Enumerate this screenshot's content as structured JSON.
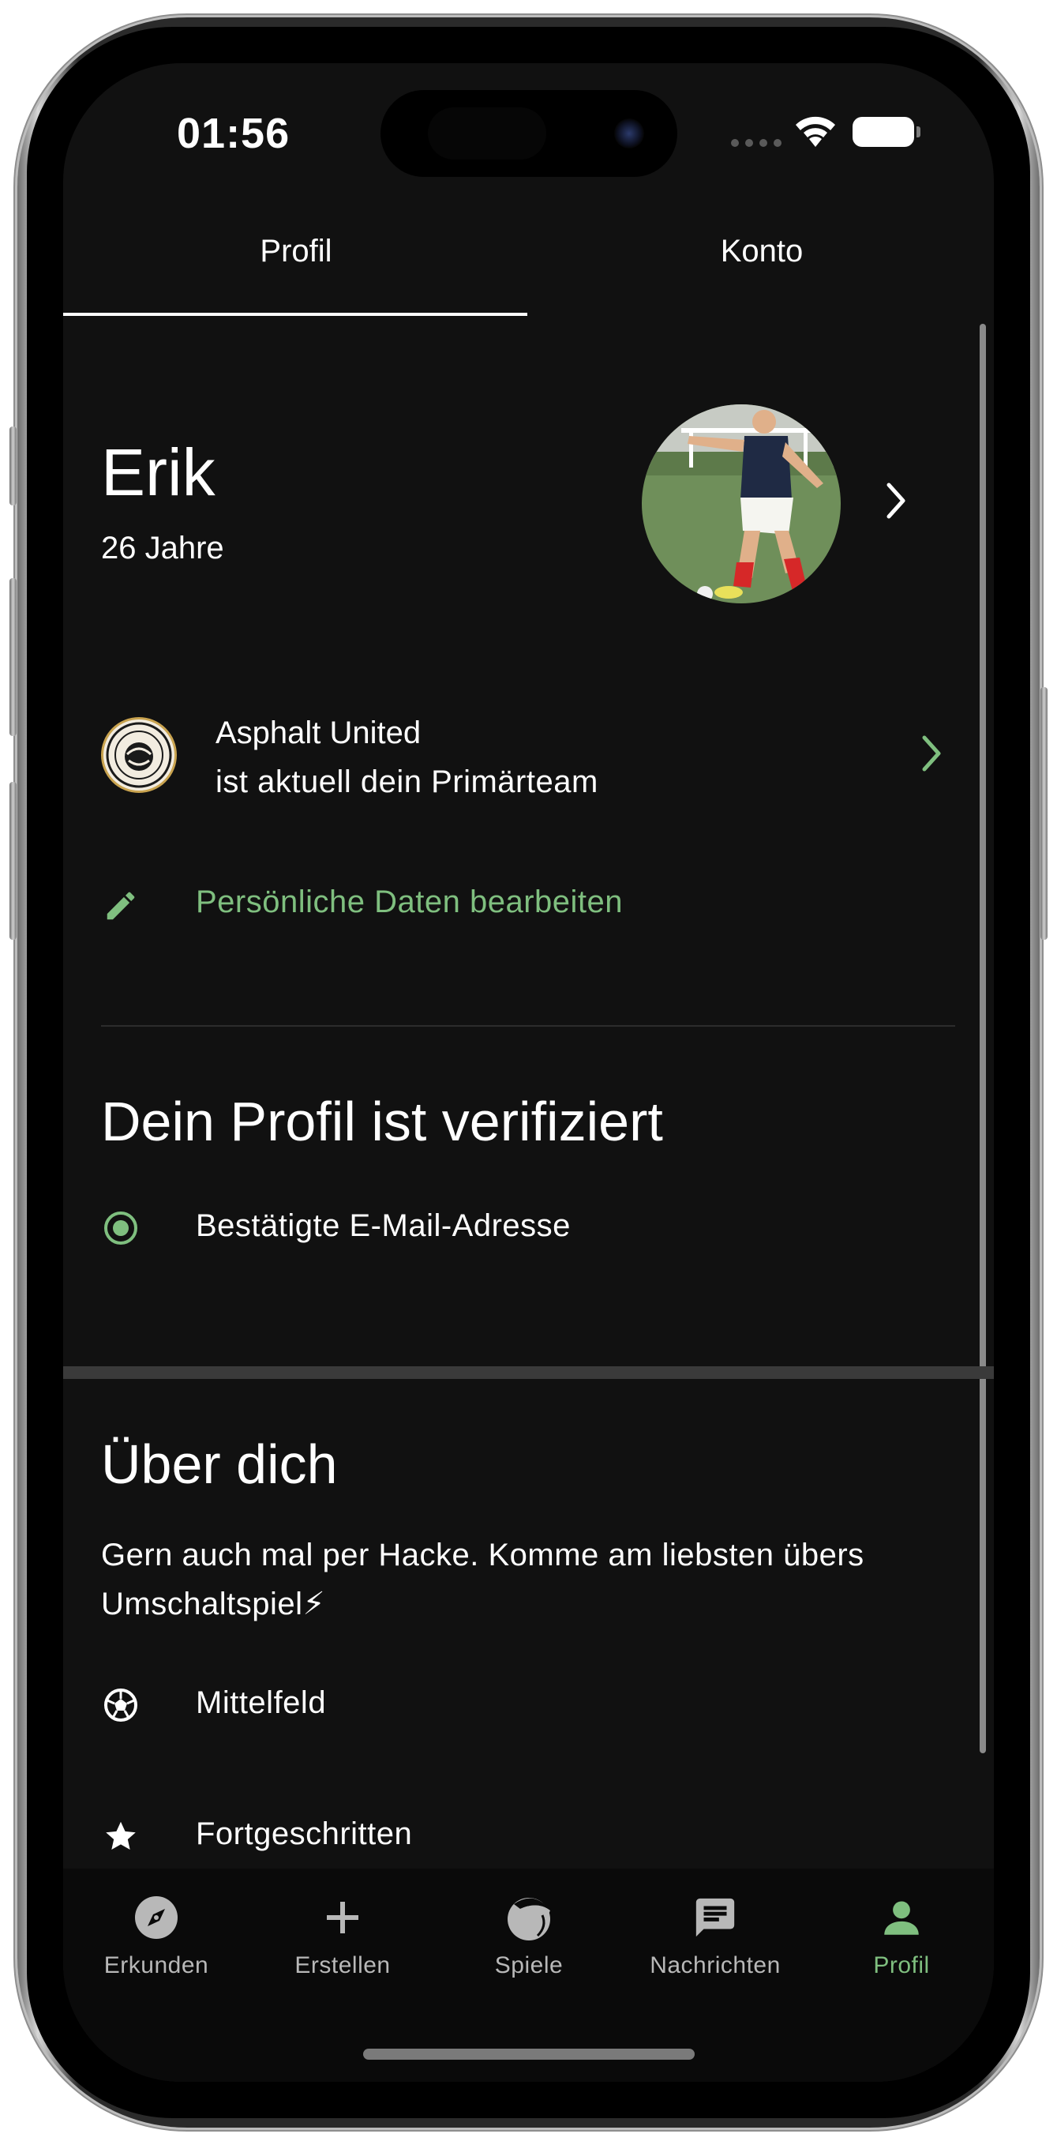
{
  "status_bar": {
    "time": "01:56"
  },
  "tabs": [
    {
      "label": "Profil",
      "active": true
    },
    {
      "label": "Konto",
      "active": false
    }
  ],
  "profile": {
    "name": "Erik",
    "age": "26 Jahre",
    "avatar_icon": "player-photo"
  },
  "team": {
    "name": "Asphalt United",
    "subtitle": "ist aktuell dein Primärteam",
    "logo_icon": "team-crest"
  },
  "edit": {
    "label": "Persönliche Daten bearbeiten",
    "icon": "pencil-icon"
  },
  "verified": {
    "title": "Dein Profil ist verifiziert",
    "items": [
      {
        "label": "Bestätigte E-Mail-Adresse",
        "icon": "radio-checked-icon"
      }
    ]
  },
  "about": {
    "title": "Über dich",
    "text": "Gern auch mal per Hacke. Komme am liebsten übers Umschaltspiel⚡",
    "position": "Mittelfeld",
    "level": "Fortgeschritten"
  },
  "nav": {
    "items": [
      {
        "label": "Erkunden",
        "icon": "compass-icon"
      },
      {
        "label": "Erstellen",
        "icon": "plus-icon"
      },
      {
        "label": "Spiele",
        "icon": "games-icon"
      },
      {
        "label": "Nachrichten",
        "icon": "chat-icon"
      },
      {
        "label": "Profil",
        "icon": "person-icon",
        "active": true
      }
    ]
  },
  "colors": {
    "accent": "#7fbf7f",
    "background": "#111111",
    "text": "#ffffff"
  }
}
